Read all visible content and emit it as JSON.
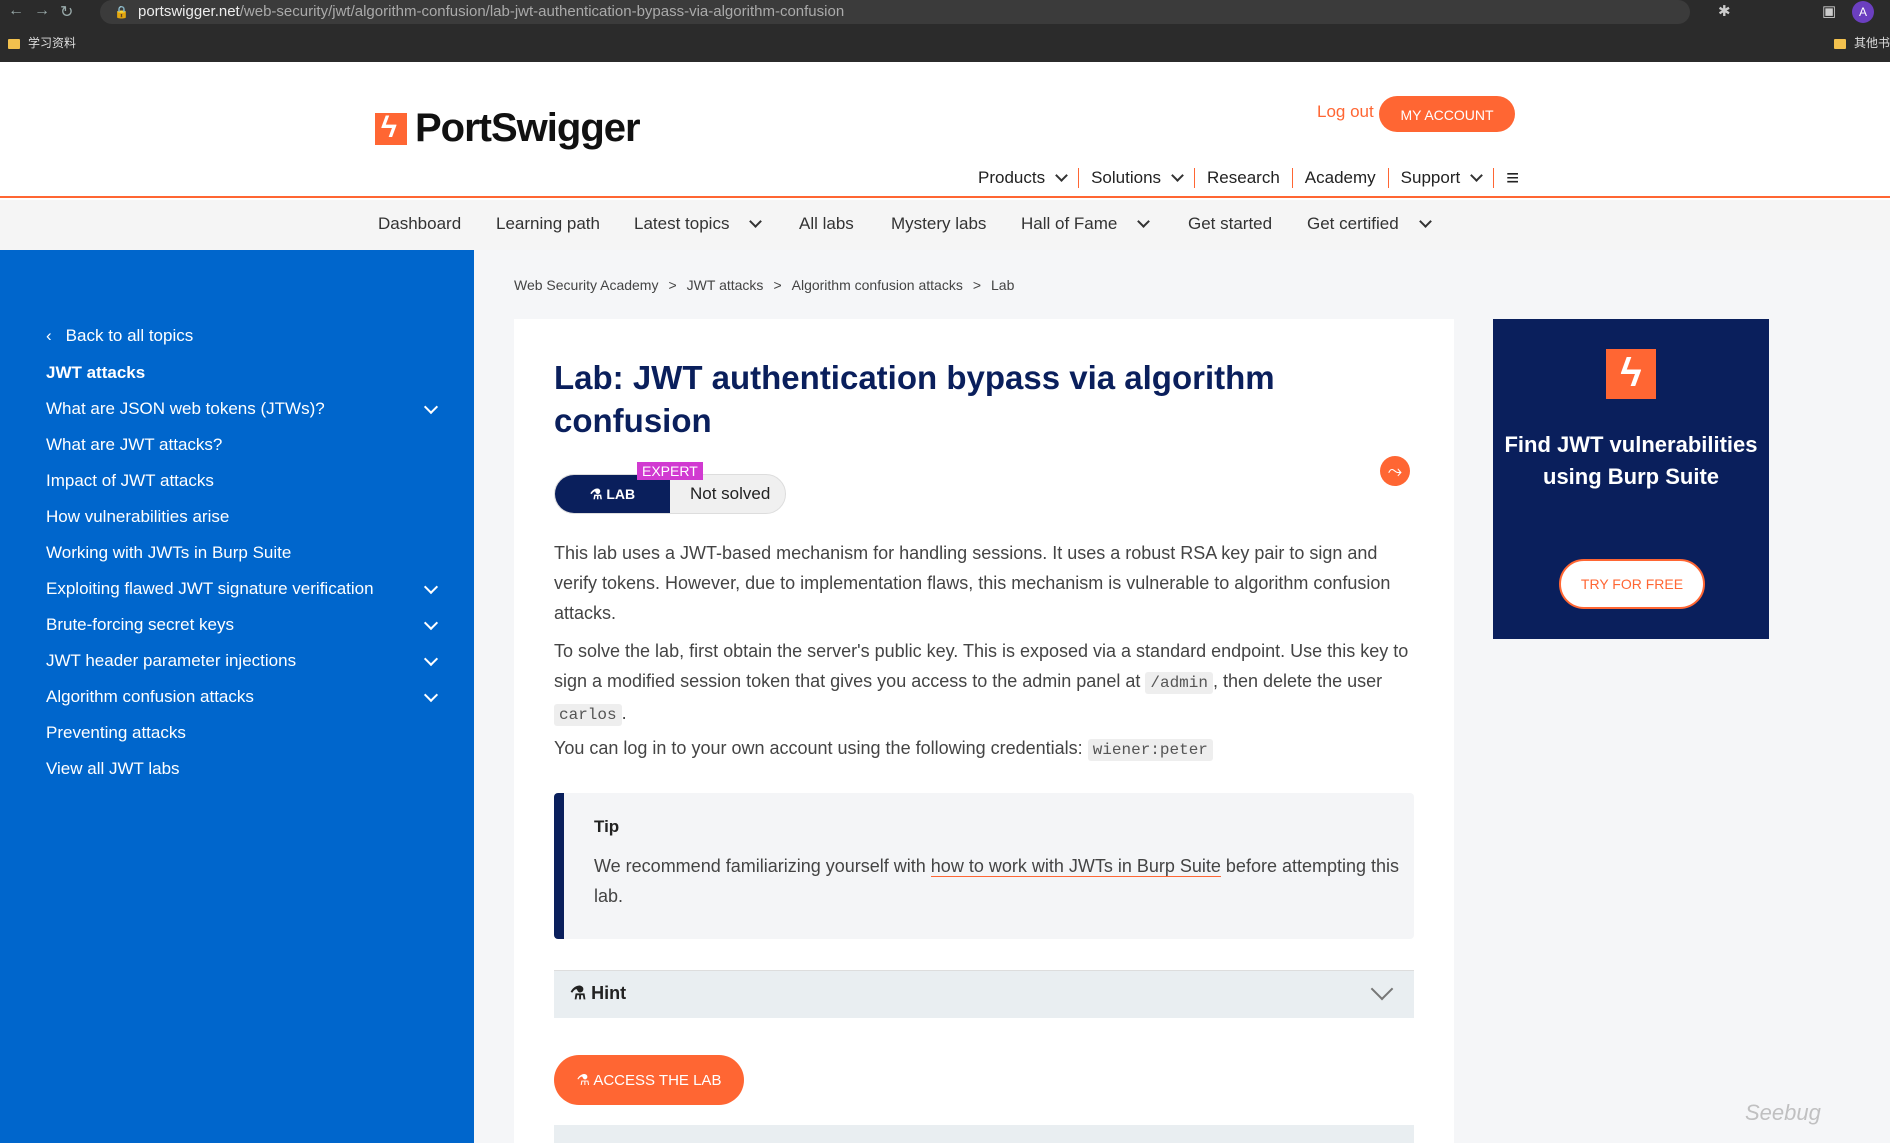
{
  "browser": {
    "url_host": "portswigger.net",
    "url_path": "/web-security/jwt/algorithm-confusion/lab-jwt-authentication-bypass-via-algorithm-confusion",
    "bookmark_left": "学习资料",
    "bookmark_right": "其他书",
    "profile_initial": "A"
  },
  "header": {
    "logo_text": "PortSwigger",
    "logout_label": "Log out",
    "my_account_label": "MY ACCOUNT",
    "nav": [
      "Products",
      "Solutions",
      "Research",
      "Academy",
      "Support"
    ]
  },
  "subnav": [
    "Dashboard",
    "Learning path",
    "Latest topics",
    "All labs",
    "Mystery labs",
    "Hall of Fame",
    "Get started",
    "Get certified"
  ],
  "sidebar": {
    "back_label": "Back to all topics",
    "section_title": "JWT attacks",
    "items": [
      "What are JSON web tokens (JTWs)?",
      "What are JWT attacks?",
      "Impact of JWT attacks",
      "How vulnerabilities arise",
      "Working with JWTs in Burp Suite",
      "Exploiting flawed JWT signature verification",
      "Brute-forcing secret keys",
      "JWT header parameter injections",
      "Algorithm confusion attacks",
      "Preventing attacks",
      "View all JWT labs"
    ]
  },
  "breadcrumb": [
    "Web Security Academy",
    "JWT attacks",
    "Algorithm confusion attacks",
    "Lab"
  ],
  "lab": {
    "title": "Lab: JWT authentication bypass via algorithm confusion",
    "badge_level": "EXPERT",
    "badge_label": "LAB",
    "status": "Not solved",
    "desc1": "This lab uses a JWT-based mechanism for handling sessions. It uses a robust RSA key pair to sign and verify tokens. However, due to implementation flaws, this mechanism is vulnerable to algorithm confusion attacks.",
    "desc2_a": "To solve the lab, first obtain the server's public key. This is exposed via a standard endpoint. Use this key to sign a modified session token that gives you access to the admin panel at",
    "desc2_code1": "/admin",
    "desc2_b": ", then delete the user",
    "desc2_code2": "carlos",
    "desc2_c": ".",
    "desc3": "You can log in to your own account using the following credentials:",
    "desc3_code": "wiener:peter",
    "tip_heading": "Tip",
    "tip_a": "We recommend familiarizing yourself with",
    "tip_link": "how to work with JWTs in Burp Suite",
    "tip_b": "before attempting this lab.",
    "hint_label": "Hint",
    "access_label": "ACCESS THE LAB"
  },
  "ad": {
    "title": "Find JWT vulnerabilities using Burp Suite",
    "button": "TRY FOR FREE"
  },
  "watermark": "Seebug",
  "colors": {
    "accent": "#ff6633",
    "navy": "#0a1f5c",
    "sidebar": "#0066cc"
  }
}
